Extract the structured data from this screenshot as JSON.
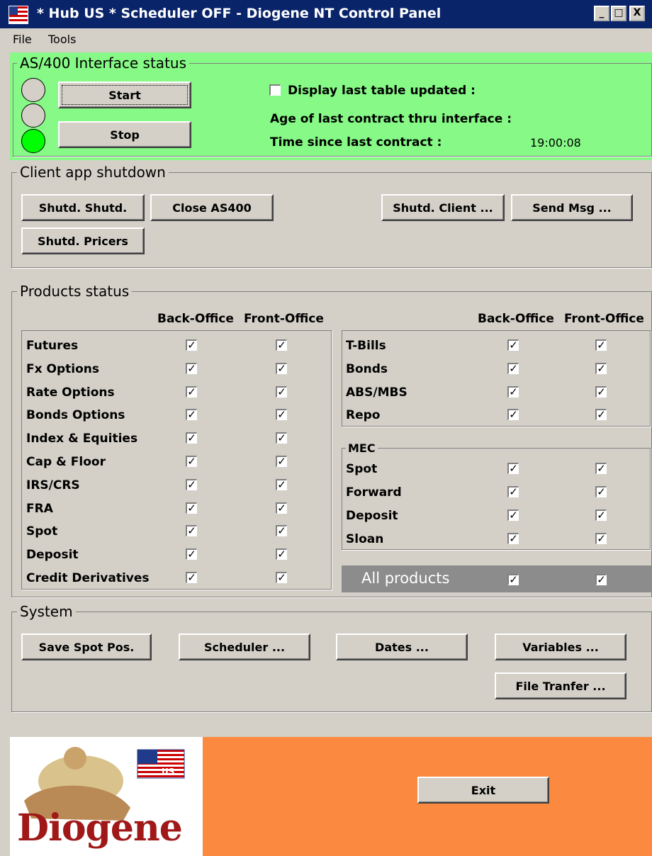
{
  "window": {
    "title": "* Hub US * Scheduler OFF - Diogene NT Control Panel",
    "min": "_",
    "max": "□",
    "close": "X"
  },
  "menu": [
    "File",
    "Tools"
  ],
  "interface": {
    "legend": "AS/400 Interface status",
    "start": "Start",
    "stop": "Stop",
    "display_label": "Display last table updated :",
    "age_label": "Age of last contract thru interface :",
    "time_label": "Time since last contract :",
    "time_value": "19:00:08",
    "bg_color": "#86f986",
    "light_on_color": "#00ff00"
  },
  "shutdown": {
    "legend": "Client app shutdown",
    "buttons": [
      "Shutd. Shutd.",
      "Close AS400",
      "Shutd. Client ...",
      "Send Msg ...",
      "Shutd. Pricers"
    ]
  },
  "products": {
    "legend": "Products status",
    "col_back": "Back-Office",
    "col_front": "Front-Office",
    "left_items": [
      "Futures",
      "Fx Options",
      "Rate Options",
      "Bonds Options",
      "Index & Equities",
      "Cap & Floor",
      "IRS/CRS",
      "FRA",
      "Spot",
      "Deposit",
      "Credit Derivatives"
    ],
    "right_items": [
      "T-Bills",
      "Bonds",
      "ABS/MBS",
      "Repo"
    ],
    "mec_legend": "MEC",
    "mec_items": [
      "Spot",
      "Forward",
      "Deposit",
      "Sloan"
    ],
    "all_products": "All products",
    "check": "✓"
  },
  "system": {
    "legend": "System",
    "buttons": [
      "Save Spot Pos.",
      "Scheduler ...",
      "Dates ...",
      "Variables ...",
      "File Tranfer ..."
    ]
  },
  "footer": {
    "logo_text": "Diogene",
    "flag_text": "US",
    "exit": "Exit",
    "bg_color": "#fb8a40"
  }
}
